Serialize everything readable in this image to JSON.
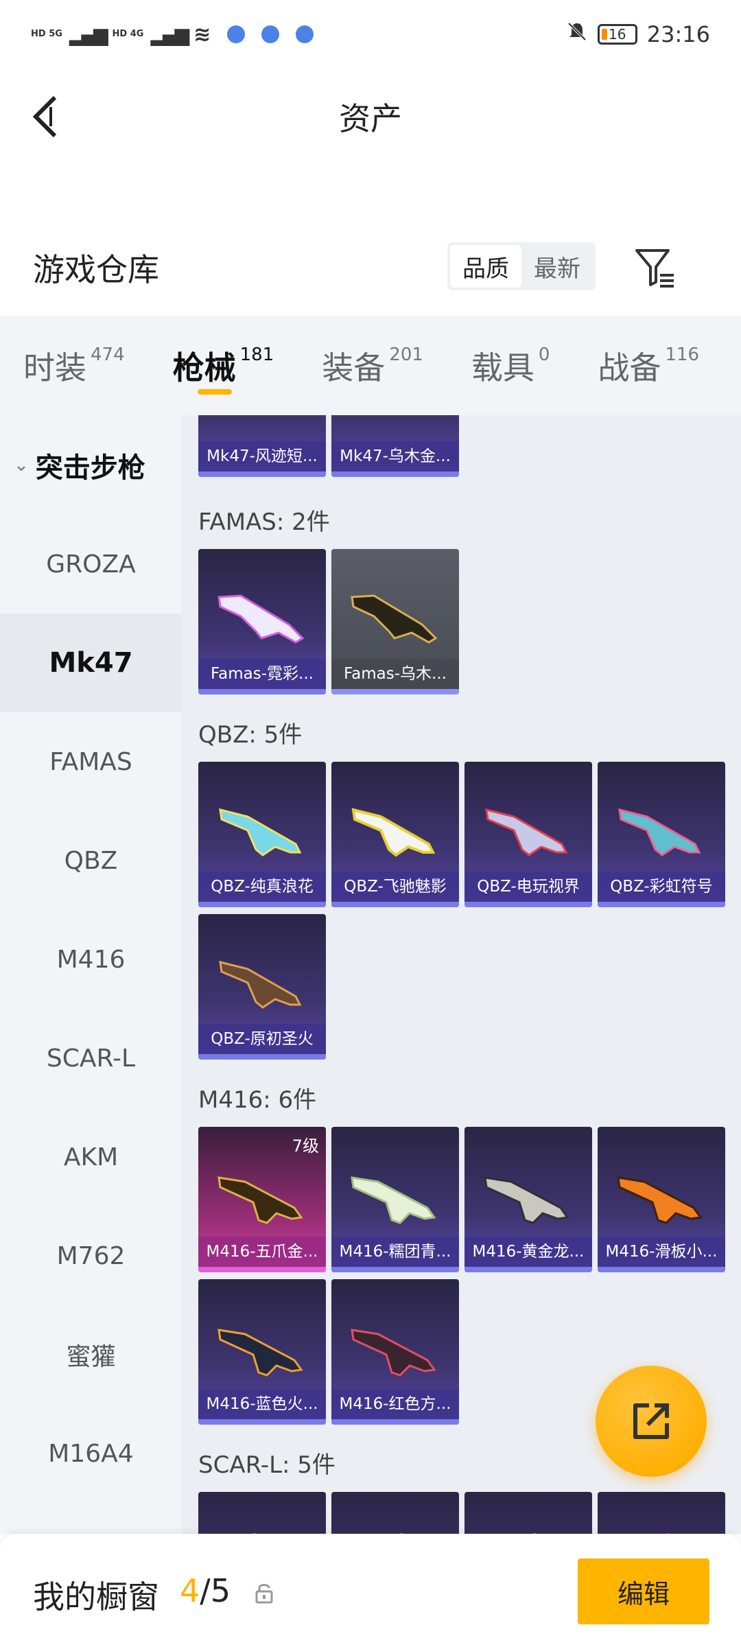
{
  "status_bar": {
    "network_1": "HD 5G",
    "network_2": "HD 4G",
    "time": "23:16",
    "battery": "16"
  },
  "header": {
    "title": "资产"
  },
  "warehouse": {
    "title": "游戏仓库",
    "sort_options": [
      "品质",
      "最新"
    ],
    "active_sort": "品质"
  },
  "tabs": [
    {
      "label": "时装",
      "count": "474"
    },
    {
      "label": "枪械",
      "count": "181"
    },
    {
      "label": "装备",
      "count": "201"
    },
    {
      "label": "载具",
      "count": "0"
    },
    {
      "label": "战备",
      "count": "116"
    }
  ],
  "sidebar": {
    "category": "突击步枪",
    "items": [
      "GROZA",
      "Mk47",
      "FAMAS",
      "QBZ",
      "M416",
      "SCAR-L",
      "AKM",
      "M762",
      "蜜獾",
      "M16A4"
    ],
    "active_item": "Mk47"
  },
  "content": {
    "partial_top_cards": [
      "Mk47-风迹短...",
      "Mk47-乌木金..."
    ],
    "groups": [
      {
        "header": "FAMAS: 2件",
        "cards": [
          {
            "label": "Famas-霓彩...",
            "style": "purple"
          },
          {
            "label": "Famas-乌木...",
            "style": "gray"
          }
        ]
      },
      {
        "header": "QBZ: 5件",
        "cards": [
          {
            "label": "QBZ-纯真浪花",
            "style": "purple"
          },
          {
            "label": "QBZ-飞驰魅影",
            "style": "purple"
          },
          {
            "label": "QBZ-电玩视界",
            "style": "purple"
          },
          {
            "label": "QBZ-彩虹符号",
            "style": "purple"
          },
          {
            "label": "QBZ-原初圣火",
            "style": "purple"
          }
        ]
      },
      {
        "header": "M416: 6件",
        "cards": [
          {
            "label": "M416-五爪金...",
            "style": "pink",
            "badge": "7级"
          },
          {
            "label": "M416-糯团青...",
            "style": "purple"
          },
          {
            "label": "M416-黄金龙...",
            "style": "purple"
          },
          {
            "label": "M416-滑板小...",
            "style": "purple"
          },
          {
            "label": "M416-蓝色火...",
            "style": "purple"
          },
          {
            "label": "M416-红色方...",
            "style": "purple"
          }
        ]
      },
      {
        "header": "SCAR-L: 5件"
      }
    ]
  },
  "bottom_bar": {
    "title": "我的橱窗",
    "current": "4",
    "separator": "/",
    "total": "5",
    "edit_label": "编辑"
  },
  "colors": {
    "accent": "#ffb400",
    "card_purple": "#3e3470",
    "card_pink": "#a2307c",
    "card_gray": "#5b5e68",
    "tab_bg": "#f2f5f8"
  },
  "icons": {
    "back": "chevron-left-icon",
    "filter": "filter-icon",
    "fab": "share-out-icon",
    "lock": "lock-icon"
  }
}
